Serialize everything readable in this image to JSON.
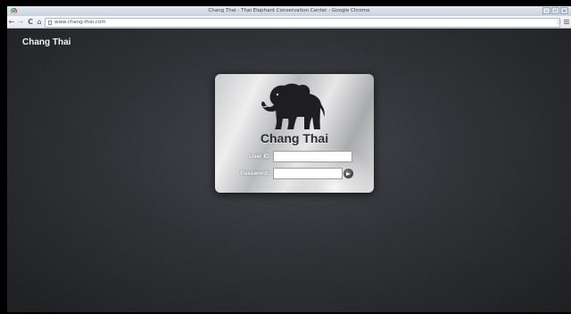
{
  "browser": {
    "window_title": "Chang Thai - Thai Elephant Conservation Center - Google Chrome",
    "url": "www.chang-thai.com",
    "controls": {
      "minimize": "–",
      "maximize": "□",
      "close": "✕"
    },
    "nav": {
      "back": "←",
      "forward": "→",
      "reload": "C",
      "home": "⌂"
    },
    "star": "☆"
  },
  "page": {
    "brand": "Chang Thai"
  },
  "login": {
    "title": "Chang Thai",
    "user_id_label": "User ID:",
    "password_label": "Password :",
    "user_id_value": "",
    "password_value": ""
  },
  "colors": {
    "page_background": "#2f3034",
    "card_background": "#d4d5d7",
    "title_text": "#2c2c2e"
  },
  "icons": [
    "chrome-logo-icon",
    "back-icon",
    "forward-icon",
    "reload-icon",
    "home-icon",
    "page-icon",
    "star-icon",
    "menu-icon",
    "elephant-logo",
    "submit-arrow-icon"
  ]
}
